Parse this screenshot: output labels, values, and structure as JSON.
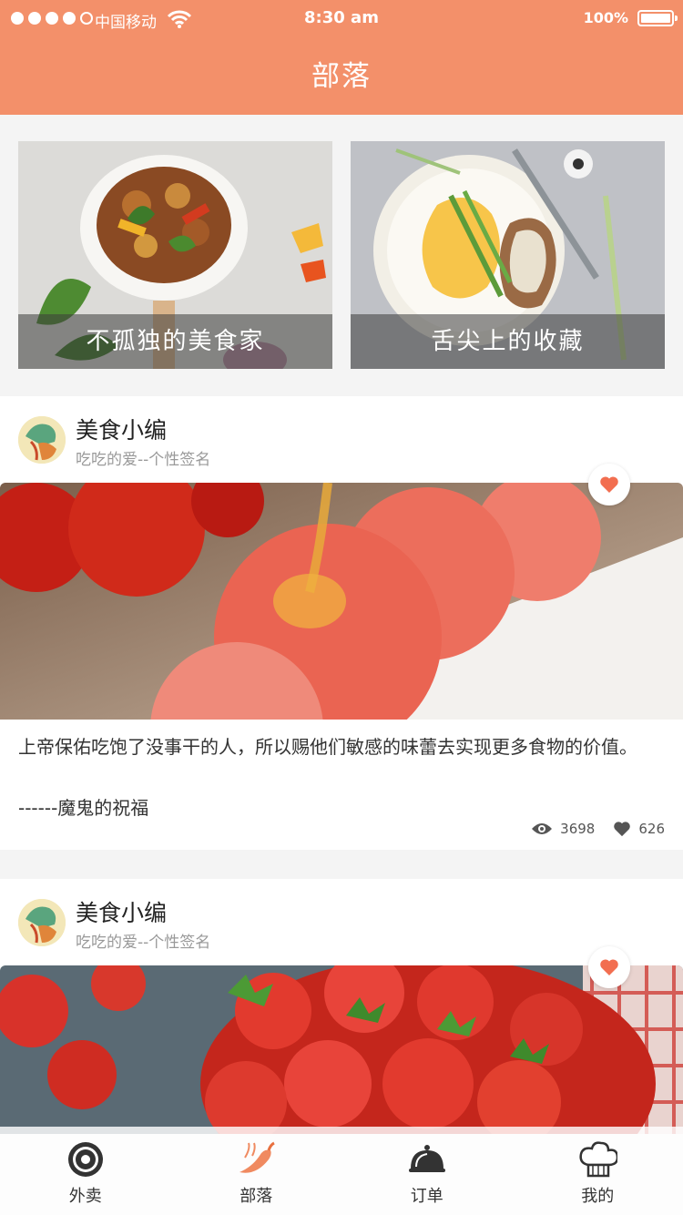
{
  "status_bar": {
    "carrier": "中国移动",
    "time": "8:30 am",
    "battery": "100%"
  },
  "header": {
    "title": "部落"
  },
  "categories": [
    {
      "label": "不孤独的美食家"
    },
    {
      "label": "舌尖上的收藏"
    }
  ],
  "posts": [
    {
      "author": "美食小编",
      "signature": "吃吃的爱--个性签名",
      "quote": "上帝保佑吃饱了没事干的人，所以赐他们敏感的味蕾去实现更多食物的价值。",
      "quote_author": "------魔鬼的祝福",
      "views": "3698",
      "likes": "626"
    },
    {
      "author": "美食小编",
      "signature": "吃吃的爱--个性签名"
    }
  ],
  "tabbar": {
    "items": [
      {
        "label": "外卖",
        "icon": "gear-icon"
      },
      {
        "label": "部落",
        "icon": "chili-icon"
      },
      {
        "label": "订单",
        "icon": "cloche-icon"
      },
      {
        "label": "我的",
        "icon": "chef-hat-icon"
      }
    ],
    "active": "部落"
  },
  "colors": {
    "accent": "#f3906a",
    "heart": "#f26e50"
  }
}
